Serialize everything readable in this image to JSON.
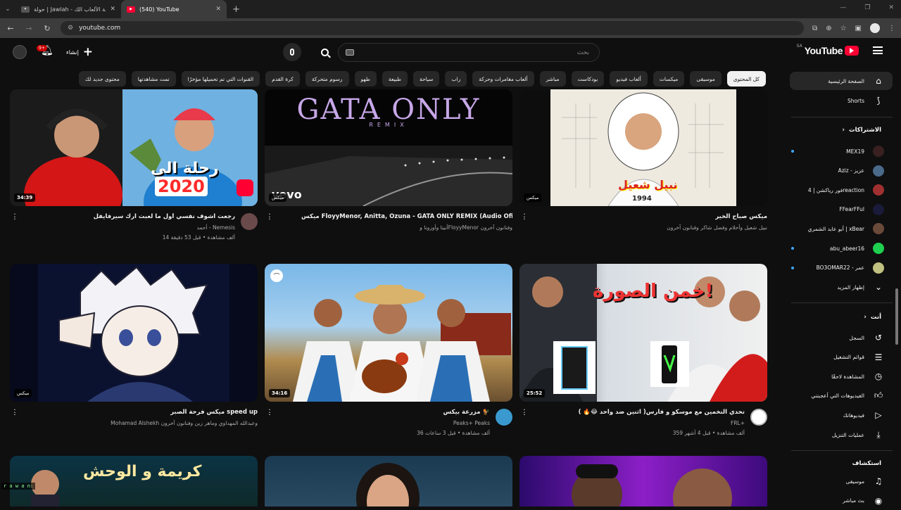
{
  "browser": {
    "tabs": [
      {
        "title": "حولة | Jawlah - منصة الألعاب الك",
        "active": false,
        "favicon": "jawlah-favicon"
      },
      {
        "title": "(540) YouTube",
        "active": true,
        "favicon": "youtube-favicon"
      }
    ],
    "url": "youtube.com"
  },
  "header": {
    "logo_text": "YouTube",
    "logo_region": "SA",
    "search_placeholder": "بحث",
    "create_label": "إنشاء",
    "notifications_badge": "9+"
  },
  "chips": [
    {
      "label": "كل المحتوى",
      "active": true
    },
    {
      "label": "موسيقى"
    },
    {
      "label": "ميكسات"
    },
    {
      "label": "ألعاب فيديو"
    },
    {
      "label": "بودكاست"
    },
    {
      "label": "مباشر"
    },
    {
      "label": "ألعاب مغامرات وحركة"
    },
    {
      "label": "راب"
    },
    {
      "label": "سياحة"
    },
    {
      "label": "طبيعة"
    },
    {
      "label": "طهو"
    },
    {
      "label": "رسوم متحركة"
    },
    {
      "label": "كرة القدم"
    },
    {
      "label": "القنوات التي تم تحميلها مؤخرًا"
    },
    {
      "label": "تمت مشاهدتها"
    },
    {
      "label": "محتوى جديد لك"
    }
  ],
  "sidebar": {
    "main": [
      {
        "label": "الصفحة الرئيسية",
        "icon": "home-icon",
        "active": true
      },
      {
        "label": "Shorts",
        "icon": "shorts-icon"
      }
    ],
    "subscriptions_title": "الاشتراكات",
    "subscriptions": [
      {
        "label": "MEX19",
        "new": true,
        "color": "#3a2020"
      },
      {
        "label": "Aziz - عزيز",
        "new": false,
        "color": "#4a6a8a"
      },
      {
        "label": "فور رياكشن | 4reaction",
        "new": false,
        "color": "#a03030"
      },
      {
        "label": "FFearFFul",
        "new": false,
        "color": "#1a1a3a"
      },
      {
        "label": "أبو عابد الشمري | xBear",
        "new": false,
        "color": "#6a4a3a"
      },
      {
        "label": "abu_abeer16",
        "new": true,
        "color": "#1fcf4f"
      },
      {
        "label": "BO3OMAR22 - عمر",
        "new": true,
        "color": "#c0c080"
      }
    ],
    "show_more": "إظهار المزيد",
    "you_title": "أنت",
    "you_items": [
      {
        "label": "السجل",
        "icon": "history-icon"
      },
      {
        "label": "قوائم التشغيل",
        "icon": "playlists-icon"
      },
      {
        "label": "المشاهدة لاحقًا",
        "icon": "watch-later-icon"
      },
      {
        "label": "الفيديوهات التي أعجبتني",
        "icon": "like-icon"
      },
      {
        "label": "فيديوهاتك",
        "icon": "your-videos-icon"
      },
      {
        "label": "عمليات التنزيل",
        "icon": "download-icon"
      }
    ],
    "explore_title": "استكشاف",
    "explore_items": [
      {
        "label": "موسيقى",
        "icon": "music-icon"
      },
      {
        "label": "بث مباشر",
        "icon": "live-icon"
      }
    ]
  },
  "videos": [
    {
      "title": "رجعت اشوف نفسي أول ما لعبت ارك سيرفايفل",
      "channel": "أحمد - Nemesis",
      "stats": "14 ألف مشاهدة • قبل 53 دقيقة",
      "duration": "34:39",
      "avatar": true,
      "avatar_color": "#6a4a4a"
    },
    {
      "title": "ميكس FloyyMenor, Anitta, Ozuna - GATA ONLY REMIX (Audio Oficial)",
      "channel": "أنيتا وأوزونا وFloyyMenor وفنانون آخرون",
      "stats": "",
      "duration": "ميكس",
      "avatar": false,
      "overlay_title": "GATA ONLY",
      "overlay_sub": "REMIX"
    },
    {
      "title": "ميكس صباح الخير",
      "channel": "نبيل شعيل وأحلام وفضل شاكر وفنانون آخرون",
      "stats": "",
      "duration": "ميكس",
      "avatar": false
    },
    {
      "title": "ميكس فرحة الصبر speed up",
      "channel": "Mohamad Alshekh وعبدالله المهداوي وماهر زين وفنانون آخرون",
      "stats": "",
      "duration": "ميكس",
      "avatar": false
    },
    {
      "title": "مزرعة بيكس 🐓",
      "channel": "Peaks+ Peaks",
      "stats": "36 ألف مشاهدة • قبل 3 ساعات",
      "duration": "34:16",
      "avatar": true,
      "avatar_color": "#3a9ad0"
    },
    {
      "title": "تحدي التخمين مع موسكو و فارس( اثنين ضد واحد 😂🔥 )",
      "channel": "FRL+",
      "stats": "359 ألف مشاهدة • قبل 4 أشهر",
      "duration": "25:52",
      "avatar": true,
      "avatar_color": "#ffffff"
    }
  ],
  "thumb_text": {
    "v1": "رحلة الى",
    "v1_year": "2020",
    "v3_year": "1994",
    "v3_name": "نبيل شعيل",
    "v6": "خمن الصورة!",
    "v7": "كريمة و الوحش"
  },
  "overlay_chat": "r a w a n:"
}
